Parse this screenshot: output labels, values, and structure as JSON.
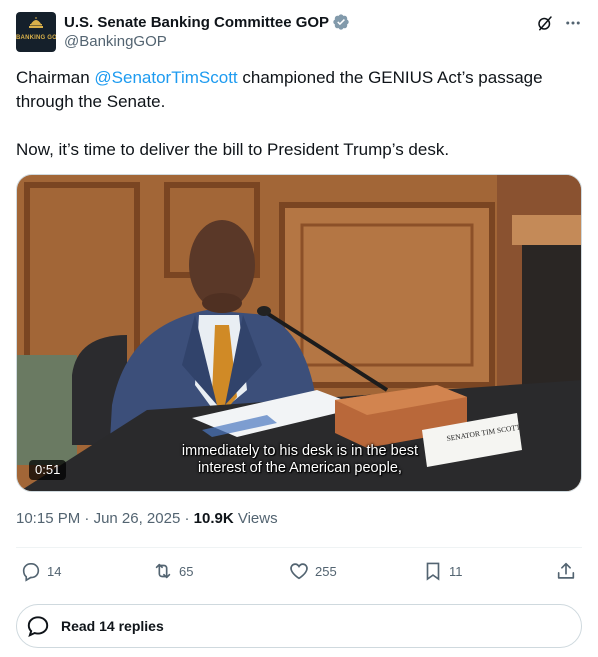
{
  "account": {
    "display_name": "U.S. Senate Banking Committee GOP",
    "handle": "@BankingGOP",
    "avatar_text": "BANKING GOP"
  },
  "tweet": {
    "text_before_mention": "Chairman ",
    "mention": "@SenatorTimScott",
    "text_after_mention": " championed the GENIUS Act’s passage through the Senate.",
    "paragraph_2": "Now, it’s time to deliver the bill to President Trump’s desk."
  },
  "media": {
    "caption_line_1": "immediately to his desk is in the best",
    "caption_line_2": "interest of the American people,",
    "duration": "0:51",
    "nameplate": "SENATOR TIM SCOTT"
  },
  "meta": {
    "time": "10:15 PM",
    "separator": "·",
    "date": "Jun 26, 2025",
    "views_count": "10.9K",
    "views_label": "Views"
  },
  "actions": {
    "replies": "14",
    "reposts": "65",
    "likes": "255",
    "bookmarks": "11"
  },
  "read_replies_label": "Read 14 replies",
  "colors": {
    "link": "#1d9bf0",
    "secondary_text": "#536471",
    "verified_badge": "#829aab",
    "border": "#cfd9de"
  },
  "icons": [
    "verified-badge-icon",
    "grok-icon",
    "more-icon",
    "reply-icon",
    "repost-icon",
    "like-icon",
    "bookmark-icon",
    "share-icon",
    "speech-bubble-icon"
  ]
}
